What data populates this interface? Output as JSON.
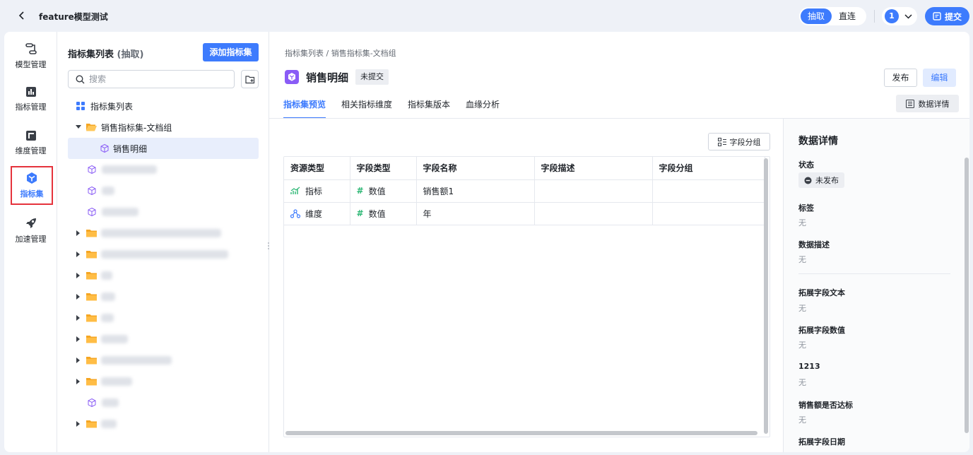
{
  "topbar": {
    "title": "feature模型测试",
    "mode_options": [
      "抽取",
      "直连"
    ],
    "active_mode": "抽取",
    "user_avatar_text": "1",
    "submit_label": "提交"
  },
  "leftnav": {
    "items": [
      {
        "label": "模型管理",
        "icon": "model-icon"
      },
      {
        "label": "指标管理",
        "icon": "metric-chart-icon"
      },
      {
        "label": "维度管理",
        "icon": "dimension-icon"
      },
      {
        "label": "指标集",
        "icon": "cube-icon",
        "active": true
      },
      {
        "label": "加速管理",
        "icon": "rocket-icon"
      }
    ]
  },
  "tree": {
    "title": "指标集列表",
    "title_suffix": "(抽取)",
    "add_button": "添加指标集",
    "search_placeholder": "搜索",
    "root_label": "指标集列表",
    "folder_label": "销售指标集-文档组",
    "selected_item": "销售明细"
  },
  "content": {
    "breadcrumb": "指标集列表 / 销售指标集-文档组",
    "page_title": "销售明细",
    "status_tag": "未提交",
    "publish_button": "发布",
    "edit_button": "编辑",
    "tabs": [
      "指标集预览",
      "相关指标维度",
      "指标集版本",
      "血缘分析"
    ],
    "active_tab": "指标集预览",
    "detail_button": "数据详情",
    "field_group_button": "字段分组"
  },
  "table": {
    "headers": [
      "资源类型",
      "字段类型",
      "字段名称",
      "字段描述",
      "字段分组"
    ],
    "rows": [
      {
        "resource_type": "指标",
        "field_type": "数值",
        "field_name": "销售额1",
        "desc": "",
        "group": ""
      },
      {
        "resource_type": "维度",
        "field_type": "数值",
        "field_name": "年",
        "desc": "",
        "group": ""
      }
    ]
  },
  "detail": {
    "title": "数据详情",
    "status_label": "状态",
    "status_value": "未发布",
    "tags_label": "标签",
    "tags_value": "无",
    "desc_label": "数据描述",
    "desc_value": "无",
    "ext_text_label": "拓展字段文本",
    "ext_text_value": "无",
    "ext_num_label": "拓展字段数值",
    "ext_num_value": "无",
    "field_1213_label": "1213",
    "field_1213_value": "无",
    "sales_target_label": "销售额是否达标",
    "sales_target_value": "无",
    "ext_date_label": "拓展字段日期"
  },
  "colors": {
    "accent": "#3d7bfd",
    "highlight_border": "#e5333c",
    "purple_icon": "#8a5cf6",
    "folder": "#f5a623",
    "metric_green": "#2bb673"
  }
}
